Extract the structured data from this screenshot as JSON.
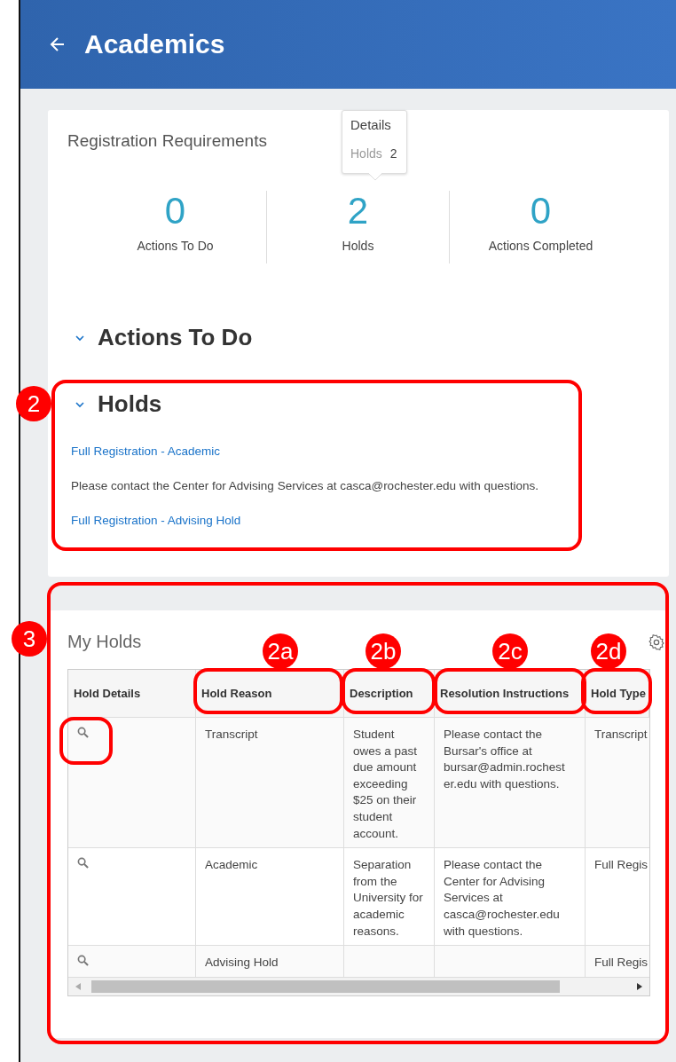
{
  "header": {
    "title": "Academics"
  },
  "summary": {
    "title": "Registration Requirements",
    "tooltip": {
      "title": "Details",
      "label": "Holds",
      "value": "2"
    },
    "stats": [
      {
        "value": "0",
        "label": "Actions To Do"
      },
      {
        "value": "2",
        "label": "Holds"
      },
      {
        "value": "0",
        "label": "Actions Completed"
      }
    ]
  },
  "sections": [
    {
      "title": "Actions To Do",
      "expanded": true
    },
    {
      "title": "Holds",
      "expanded": true,
      "items": [
        {
          "kind": "link",
          "text": "Full Registration - Academic"
        },
        {
          "kind": "note",
          "text": "Please contact the Center for Advising Services at casca@rochester.edu with questions."
        },
        {
          "kind": "link",
          "text": "Full Registration - Advising Hold"
        }
      ]
    }
  ],
  "my_holds": {
    "title": "My Holds",
    "columns": [
      "Hold Details",
      "Hold Reason",
      "Description",
      "Resolution Instructions",
      "Hold Type"
    ],
    "rows": [
      {
        "hold_reason": "Transcript",
        "description": "Student owes a past due amount exceeding $25 on their student account.",
        "resolution": "Please contact the Bursar's office at bursar@admin.rochester.edu with questions.",
        "hold_type": "Transcript"
      },
      {
        "hold_reason": "Academic",
        "description": "Separation from the University for academic reasons.",
        "resolution": "Please contact the Center for Advising Services at casca@rochester.edu with questions.",
        "hold_type": "Full Regis"
      },
      {
        "hold_reason": "Advising Hold",
        "hold_type": "Full Regis"
      }
    ]
  },
  "annotations": [
    {
      "label": "2"
    },
    {
      "label": "3"
    },
    {
      "label": "2a"
    },
    {
      "label": "2b"
    },
    {
      "label": "2c"
    },
    {
      "label": "2d"
    }
  ]
}
